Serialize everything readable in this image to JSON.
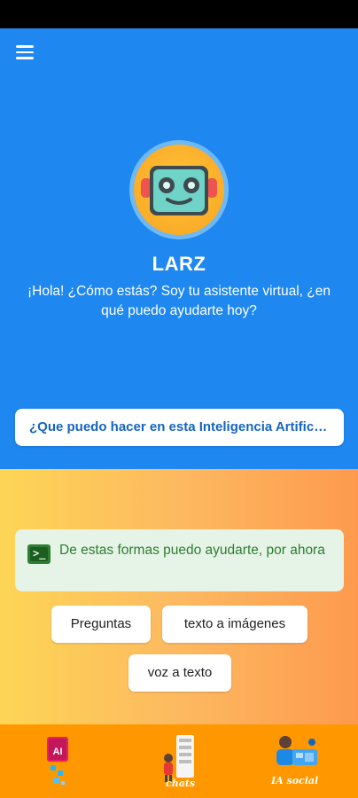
{
  "app": {
    "bot_name": "LARZ",
    "greeting": "¡Hola! ¿Cómo estás? Soy tu asistente virtual, ¿en qué puedo ayudarte hoy?",
    "question_button": "¿Que puedo hacer en esta Inteligencia Artificial?"
  },
  "info": {
    "text": "De estas formas puedo ayudarte, por ahora"
  },
  "options": [
    {
      "label": "Preguntas"
    },
    {
      "label": "texto a imágenes"
    },
    {
      "label": "voz a texto"
    }
  ],
  "bottom_nav": {
    "ai_badge": "AI",
    "chats_label": "chats",
    "social_label": "IA social"
  },
  "colors": {
    "primary": "#1E88F0",
    "nav": "#FF9800",
    "gradient_start": "#FDD555",
    "gradient_end": "#FD9A4E"
  }
}
